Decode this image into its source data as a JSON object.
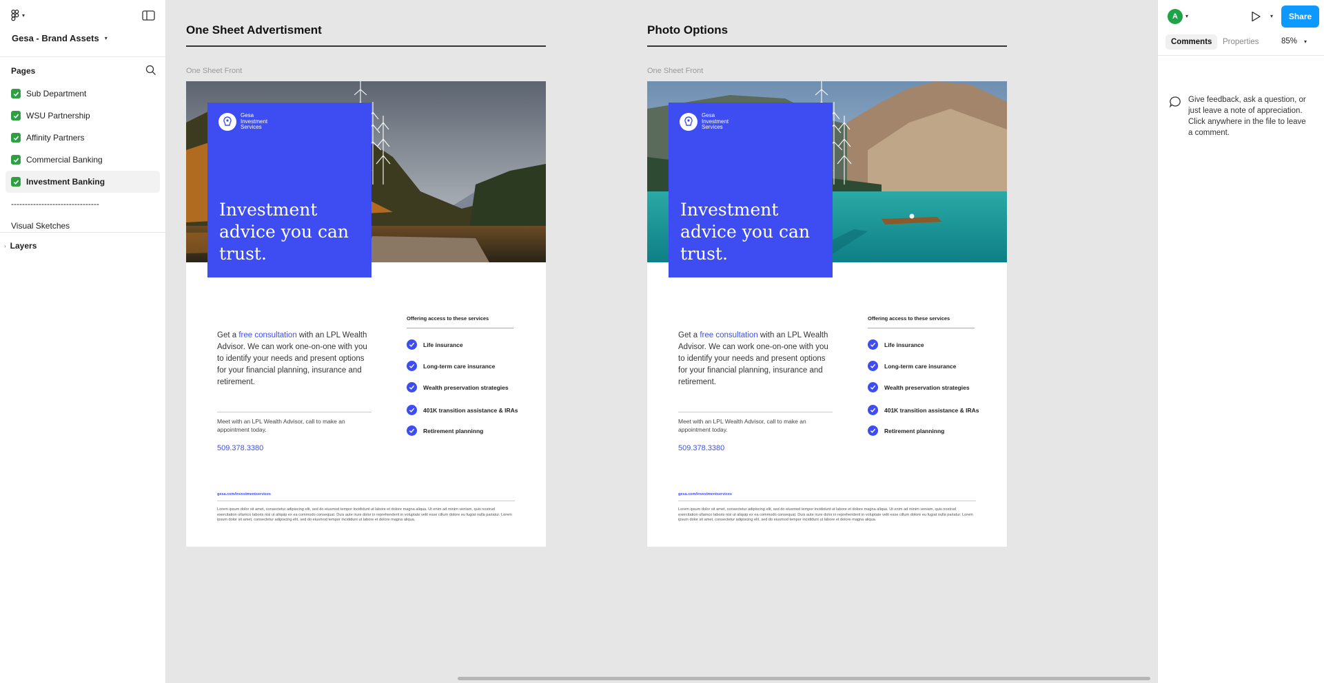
{
  "file": {
    "title": "Gesa - Brand Assets"
  },
  "pages": {
    "heading": "Pages",
    "items": [
      {
        "label": "Sub Department",
        "done": true
      },
      {
        "label": "WSU Partnership",
        "done": true
      },
      {
        "label": "Affinity Partners",
        "done": true
      },
      {
        "label": "Commercial Banking",
        "done": true
      },
      {
        "label": "Investment Banking",
        "done": true,
        "active": true
      }
    ],
    "separator": "--------------------------------",
    "extra": "Visual Sketches"
  },
  "layers": {
    "heading": "Layers"
  },
  "frames": [
    {
      "title": "One Sheet Advertisment",
      "caption": "One Sheet Front",
      "brand": [
        "Gesa",
        "Investment",
        "Services"
      ],
      "headline": "Investment advice you can trust.",
      "lead_pre": "Get a ",
      "lead_link": "free consultation",
      "lead_post": " with an LPL Wealth Advisor. We can work one-on-one with you to identify your needs and present options for your financial planning, insurance and retirement.",
      "meet": "Meet with an LPL Wealth Advisor, call to make an appointment today.",
      "phone": "509.378.3380",
      "services_heading": "Offering access to these services",
      "services": [
        "Life insurance",
        "Long-term care insurance",
        "Wealth preservation strategies",
        "401K transition assistance & IRAs",
        "Retirement planninng"
      ],
      "website": "gesa.com/investmentservices",
      "lorem": "Lorem ipsum dolor sit amet, consectetur adipiscing elit, sed do eiusmod tempor incididunt ut labore et dolore magna aliqua. Ut enim ad minim veniam, quis nostrud exercitation ullamco laboris nisi ut aliquip ex ea commodo consequat. Duis aute irure dolor in reprehenderit in voluptate velit esse cillum dolore eu fugiat nulla pariatur. Lorem ipsum dolor sit amet, consectetur adipiscing elit, sed do eiusmod tempor incididunt ut labore et dolore magna aliqua."
    },
    {
      "title": "Photo Options",
      "caption": "One Sheet Front",
      "brand": [
        "Gesa",
        "Investment",
        "Services"
      ],
      "headline": "Investment advice you can trust.",
      "lead_pre": "Get a ",
      "lead_link": "free consultation",
      "lead_post": " with an LPL Wealth Advisor. We can work one-on-one with you to identify your needs and present options for your financial planning, insurance and retirement.",
      "meet": "Meet with an LPL Wealth Advisor, call to make an appointment today.",
      "phone": "509.378.3380",
      "services_heading": "Offering access to these services",
      "services": [
        "Life insurance",
        "Long-term care insurance",
        "Wealth preservation strategies",
        "401K transition assistance & IRAs",
        "Retirement planninng"
      ],
      "website": "gesa.com/investmentservices",
      "lorem": "Lorem ipsum dolor sit amet, consectetur adipiscing elit, sed do eiusmod tempor incididunt ut labore et dolore magna aliqua. Ut enim ad minim veniam, quis nostrud exercitation ullamco laboris nisi ut aliquip ex ea commodo consequat. Duis aute irure dolor in reprehenderit in voluptate velit esse cillum dolore eu fugiat nulla pariatur. Lorem ipsum dolor sit amet, consectetur adipiscing elit, sed do eiusmod tempor incididunt ut labore et dolore magna aliqua."
    }
  ],
  "right": {
    "avatar": "A",
    "share": "Share",
    "tabs": [
      "Comments",
      "Properties"
    ],
    "zoom": "85%",
    "hint": "Give feedback, ask a question, or just leave a note of appreciation. Click anywhere in the file to leave a comment."
  },
  "colors": {
    "brand_blue": "#3d4df2",
    "share_blue": "#0d99ff",
    "check_green": "#2ea043",
    "avatar_green": "#1ea446"
  }
}
